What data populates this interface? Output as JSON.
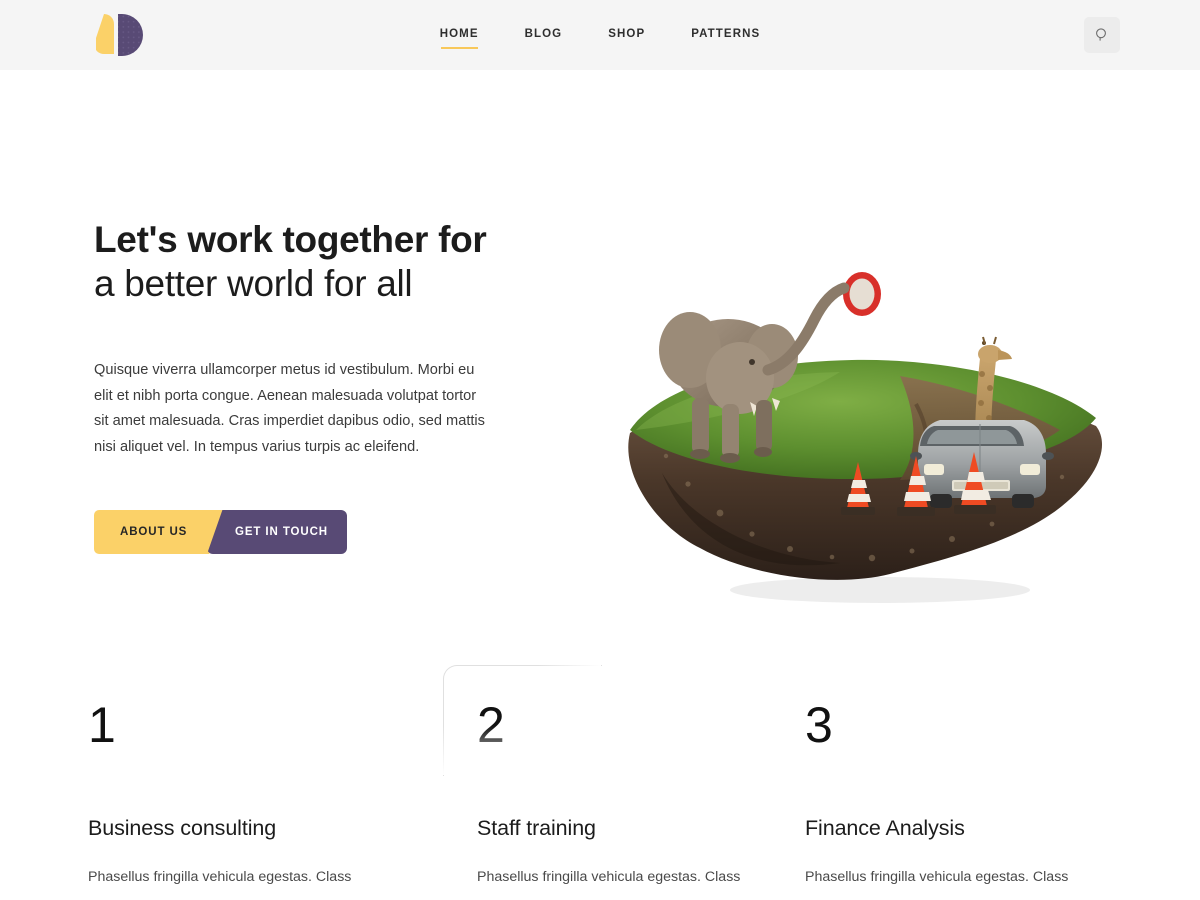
{
  "brand": {
    "logo_name": "p-logo",
    "yellow": "#fbd168",
    "purple": "#584a75"
  },
  "header": {
    "background": "#f5f5f5",
    "nav": [
      {
        "label": "HOME",
        "active": true
      },
      {
        "label": "BLOG",
        "active": false
      },
      {
        "label": "SHOP",
        "active": false
      },
      {
        "label": "PATTERNS",
        "active": false
      }
    ],
    "search": {
      "icon": "search-icon",
      "aria_label": "Search"
    }
  },
  "hero": {
    "title_line1": "Let's work together for",
    "title_line2": "a better world for all",
    "paragraph": "Quisque viverra ullamcorper metus id vestibulum. Morbi eu elit et nibh porta congue. Aenean malesuada volutpat tortor sit amet malesuada. Cras imperdiet dapibus odio, sed mattis nisi aliquet vel. In tempus varius turpis ac eleifend.",
    "buttons": {
      "primary": "ABOUT US",
      "secondary": "GET IN TOUCH"
    },
    "image": {
      "name": "floating-grass-island-photo",
      "alt": "Floating grass island with an elephant, a giraffe beside a car, orange traffic cones and a red road sign"
    }
  },
  "features": [
    {
      "number": "1",
      "title": "Business consulting",
      "desc": "Phasellus fringilla vehicula egestas. Class",
      "highlight": false
    },
    {
      "number": "2",
      "title": "Staff training",
      "desc": "Phasellus fringilla vehicula egestas. Class",
      "highlight": true
    },
    {
      "number": "3",
      "title": "Finance Analysis",
      "desc": "Phasellus fringilla vehicula egestas. Class",
      "highlight": false
    }
  ]
}
